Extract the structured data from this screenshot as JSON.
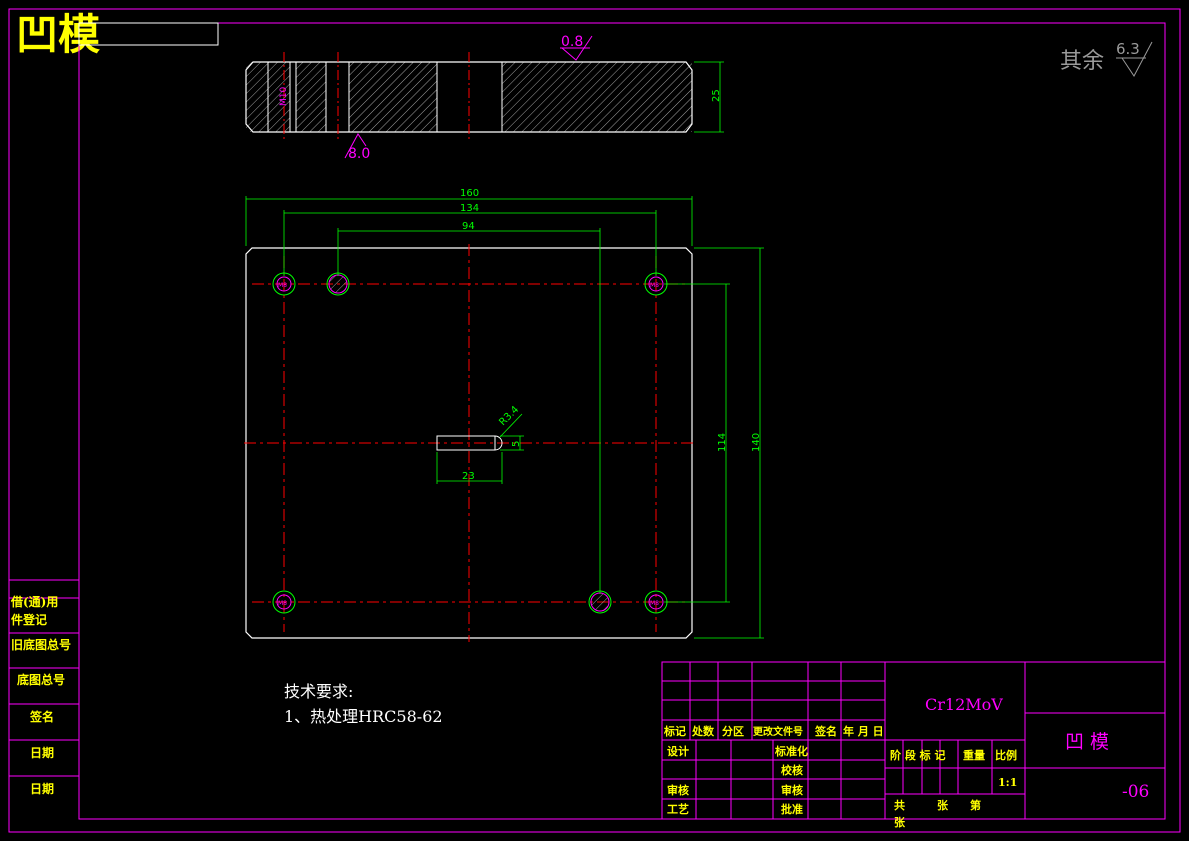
{
  "title": "凹模",
  "roughness": {
    "top": "0.8",
    "side": "8.0",
    "rest_prefix": "其余",
    "rest_value": "6.3"
  },
  "section_labels": {
    "thread": "M10",
    "height": "25"
  },
  "dimensions": {
    "width_160": "160",
    "width_134": "134",
    "width_94": "94",
    "height_140": "140",
    "height_114": "114",
    "slot_len": "23",
    "slot_w": "5",
    "slot_r": "R3.4"
  },
  "hole_label": "M8",
  "tech_req": {
    "heading": "技术要求:",
    "item1": "1、热处理HRC58-62"
  },
  "left_column": [
    "借(通)用",
    "件登记",
    "旧底图总号",
    "底图总号",
    "签名",
    "日期",
    "日期"
  ],
  "title_block": {
    "material": "Cr12MoV",
    "part_name": "凹  模",
    "drawing_no": "-06",
    "scale": "1:1",
    "header_row": [
      "标记",
      "处数",
      "分区",
      "更改文件号",
      "签名",
      "年 月 日"
    ],
    "design": "设计",
    "standardize": "标准化",
    "review": "审核",
    "craft": "工艺",
    "approve": "批准",
    "verify": "审核",
    "check": "校核",
    "stage_headers": [
      "阶 段 标 记",
      "重量",
      "比例"
    ],
    "sheets": [
      "共",
      "张",
      "第",
      "张"
    ]
  },
  "colors": {
    "frame": "#ff00ff",
    "outline": "#ffffff",
    "dim": "#00ff00",
    "center": "#ff0000",
    "title": "#ffff00",
    "text_magenta": "#ff00ff"
  }
}
